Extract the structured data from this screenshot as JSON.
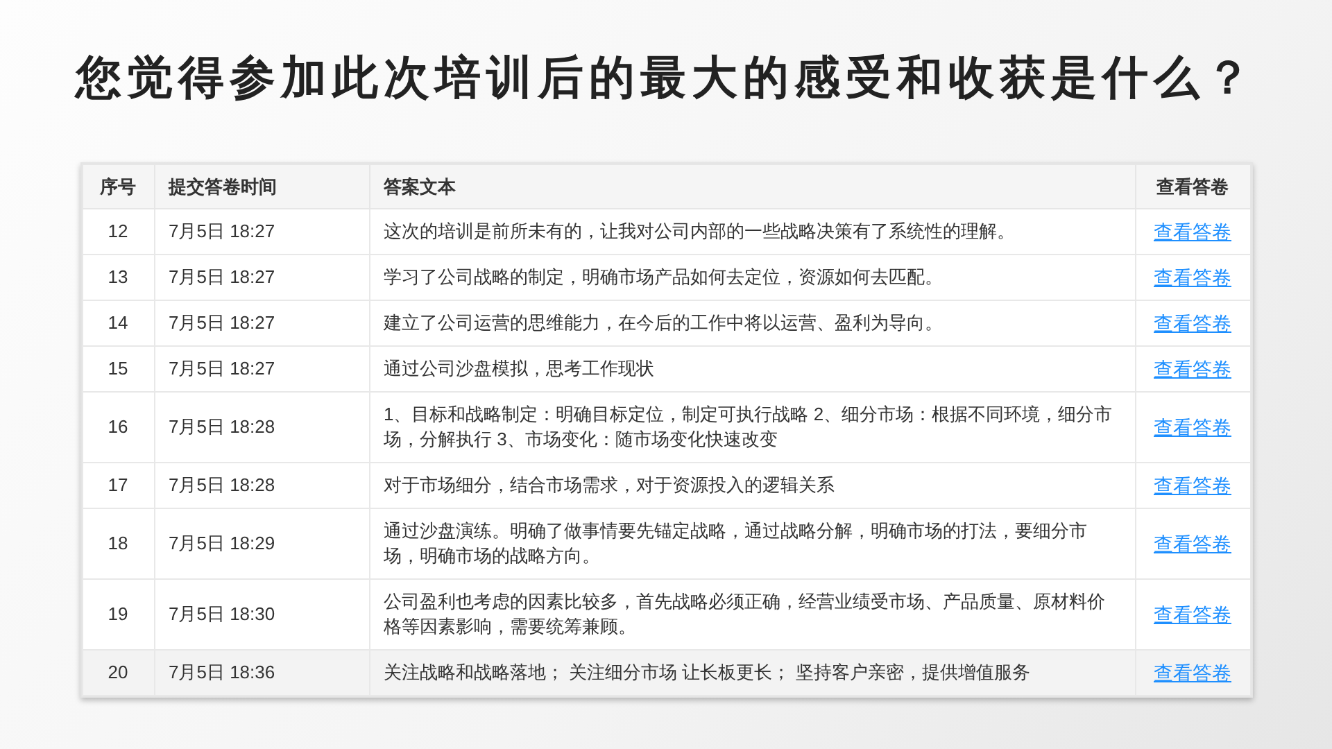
{
  "title": "您觉得参加此次培训后的最大的感受和收获是什么？",
  "table": {
    "columns": [
      "序号",
      "提交答卷时间",
      "答案文本",
      "查看答卷"
    ],
    "rows": [
      {
        "number": "12",
        "time": "7月5日 18:27",
        "answer": "这次的培训是前所未有的，让我对公司内部的一些战略决策有了系统性的理解。",
        "link": "查看答卷",
        "highlighted": false
      },
      {
        "number": "13",
        "time": "7月5日 18:27",
        "answer": "学习了公司战略的制定，明确市场产品如何去定位，资源如何去匹配。",
        "link": "查看答卷",
        "highlighted": false
      },
      {
        "number": "14",
        "time": "7月5日 18:27",
        "answer": "建立了公司运营的思维能力，在今后的工作中将以运营、盈利为导向。",
        "link": "查看答卷",
        "highlighted": false
      },
      {
        "number": "15",
        "time": "7月5日 18:27",
        "answer": "通过公司沙盘模拟，思考工作现状",
        "link": "查看答卷",
        "highlighted": false
      },
      {
        "number": "16",
        "time": "7月5日 18:28",
        "answer": "1、目标和战略制定：明确目标定位，制定可执行战略 2、细分市场：根据不同环境，细分市场，分解执行 3、市场变化：随市场变化快速改变",
        "link": "查看答卷",
        "highlighted": false
      },
      {
        "number": "17",
        "time": "7月5日 18:28",
        "answer": "对于市场细分，结合市场需求，对于资源投入的逻辑关系",
        "link": "查看答卷",
        "highlighted": false
      },
      {
        "number": "18",
        "time": "7月5日 18:29",
        "answer": "通过沙盘演练。明确了做事情要先锚定战略，通过战略分解，明确市场的打法，要细分市场，明确市场的战略方向。",
        "link": "查看答卷",
        "highlighted": false
      },
      {
        "number": "19",
        "time": "7月5日 18:30",
        "answer": "公司盈利也考虑的因素比较多，首先战略必须正确，经营业绩受市场、产品质量、原材料价格等因素影响，需要统筹兼顾。",
        "link": "查看答卷",
        "highlighted": false
      },
      {
        "number": "20",
        "time": "7月5日 18:36",
        "answer": "关注战略和战略落地； 关注细分市场 让长板更长； 坚持客户亲密，提供增值服务",
        "link": "查看答卷",
        "highlighted": true
      }
    ]
  }
}
